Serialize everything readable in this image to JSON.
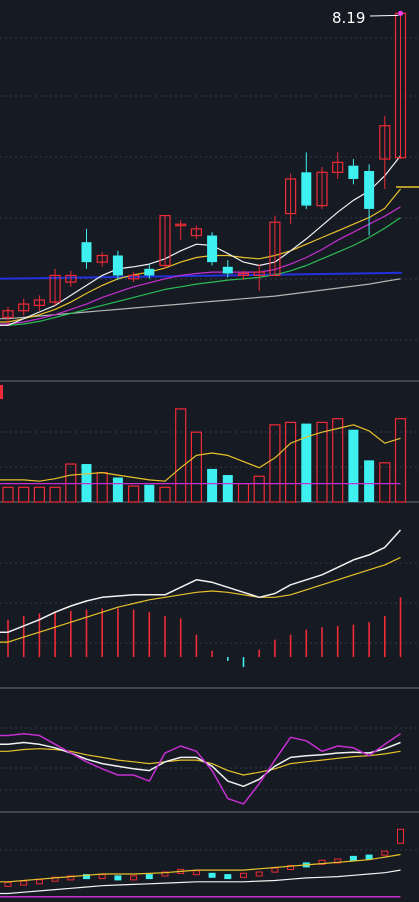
{
  "chart_data": {
    "type": "candlestick",
    "max_label": "8.19",
    "colors": {
      "background": "#161a23",
      "up": "#ef2b36",
      "down": "#3ff0f0",
      "grid": "#353a46",
      "divider": "#6a6f7a",
      "ma_white": "#f2f2f2",
      "ma_yellow": "#e8c22a",
      "ma_magenta": "#c62fd2",
      "ma_green": "#2bbd54",
      "ma_gray": "#b4b4b4",
      "blue_line": "#2233dd",
      "price_tick": "#e8c22a"
    },
    "price_ylim": [
      3.4,
      8.3
    ],
    "candles": [
      {
        "o": 3.62,
        "c": 3.72,
        "h": 3.78,
        "l": 3.52
      },
      {
        "o": 3.72,
        "c": 3.82,
        "h": 3.9,
        "l": 3.65
      },
      {
        "o": 3.8,
        "c": 3.88,
        "h": 3.95,
        "l": 3.72
      },
      {
        "o": 3.85,
        "c": 4.25,
        "h": 4.35,
        "l": 3.8
      },
      {
        "o": 4.15,
        "c": 4.25,
        "h": 4.32,
        "l": 4.08
      },
      {
        "o": 4.75,
        "c": 4.45,
        "h": 4.95,
        "l": 4.35
      },
      {
        "o": 4.45,
        "c": 4.55,
        "h": 4.6,
        "l": 4.38
      },
      {
        "o": 4.55,
        "c": 4.25,
        "h": 4.62,
        "l": 4.18
      },
      {
        "o": 4.2,
        "c": 4.25,
        "h": 4.3,
        "l": 4.15
      },
      {
        "o": 4.35,
        "c": 4.25,
        "h": 4.42,
        "l": 4.2
      },
      {
        "o": 4.4,
        "c": 5.15,
        "h": 5.15,
        "l": 4.35
      },
      {
        "o": 5.02,
        "c": 5.02,
        "h": 5.08,
        "l": 4.78
      },
      {
        "o": 4.85,
        "c": 4.95,
        "h": 5.0,
        "l": 4.8
      },
      {
        "o": 4.85,
        "c": 4.45,
        "h": 4.9,
        "l": 4.4
      },
      {
        "o": 4.38,
        "c": 4.28,
        "h": 4.48,
        "l": 4.22
      },
      {
        "o": 4.25,
        "c": 4.28,
        "h": 4.32,
        "l": 4.18
      },
      {
        "o": 4.25,
        "c": 4.3,
        "h": 4.42,
        "l": 4.02
      },
      {
        "o": 4.25,
        "c": 5.05,
        "h": 5.15,
        "l": 4.25
      },
      {
        "o": 5.18,
        "c": 5.7,
        "h": 5.78,
        "l": 5.02
      },
      {
        "o": 5.8,
        "c": 5.3,
        "h": 6.1,
        "l": 5.25
      },
      {
        "o": 5.3,
        "c": 5.8,
        "h": 5.88,
        "l": 5.25
      },
      {
        "o": 5.8,
        "c": 5.95,
        "h": 6.1,
        "l": 5.7
      },
      {
        "o": 5.9,
        "c": 5.7,
        "h": 6.0,
        "l": 5.62
      },
      {
        "o": 5.82,
        "c": 5.25,
        "h": 5.92,
        "l": 4.85
      },
      {
        "o": 6.0,
        "c": 6.5,
        "h": 6.65,
        "l": 5.55
      },
      {
        "o": 6.02,
        "c": 8.19,
        "h": 8.19,
        "l": 6.0
      }
    ],
    "ma_white": [
      3.5,
      3.6,
      3.7,
      3.8,
      3.95,
      4.1,
      4.25,
      4.35,
      4.38,
      4.42,
      4.5,
      4.62,
      4.72,
      4.7,
      4.58,
      4.45,
      4.4,
      4.45,
      4.62,
      4.8,
      5.0,
      5.2,
      5.38,
      5.52,
      5.75,
      6.05
    ],
    "ma_yellow": [
      3.55,
      3.6,
      3.66,
      3.74,
      3.85,
      3.98,
      4.1,
      4.2,
      4.26,
      4.3,
      4.36,
      4.45,
      4.52,
      4.55,
      4.55,
      4.52,
      4.5,
      4.55,
      4.62,
      4.72,
      4.82,
      4.92,
      5.02,
      5.12,
      5.26,
      5.55
    ],
    "ma_magenta": [
      3.52,
      3.55,
      3.6,
      3.66,
      3.74,
      3.82,
      3.92,
      4.0,
      4.08,
      4.14,
      4.2,
      4.25,
      4.28,
      4.3,
      4.3,
      4.3,
      4.3,
      4.34,
      4.42,
      4.52,
      4.64,
      4.78,
      4.9,
      5.02,
      5.14,
      5.28
    ],
    "ma_green": [
      3.5,
      3.52,
      3.56,
      3.62,
      3.68,
      3.74,
      3.8,
      3.86,
      3.92,
      3.98,
      4.04,
      4.08,
      4.12,
      4.15,
      4.18,
      4.2,
      4.22,
      4.26,
      4.32,
      4.4,
      4.5,
      4.6,
      4.7,
      4.82,
      4.96,
      5.12
    ],
    "ma_gray": [
      3.6,
      3.62,
      3.64,
      3.66,
      3.68,
      3.7,
      3.72,
      3.74,
      3.76,
      3.78,
      3.8,
      3.82,
      3.84,
      3.86,
      3.88,
      3.9,
      3.92,
      3.94,
      3.97,
      4.0,
      4.03,
      4.06,
      4.09,
      4.12,
      4.16,
      4.2
    ],
    "blue_level": 4.2,
    "price_tick_level": 5.58,
    "volume": [
      12,
      12,
      12,
      12,
      31,
      31,
      24,
      20,
      13,
      14,
      12,
      76,
      57,
      27,
      22,
      15,
      21,
      63,
      65,
      64,
      65,
      68,
      59,
      34,
      32,
      68
    ],
    "volume_ma_yellow": [
      18,
      18,
      17,
      19,
      22,
      23,
      24,
      22,
      20,
      18,
      17,
      28,
      38,
      40,
      38,
      33,
      28,
      36,
      48,
      53,
      57,
      60,
      63,
      58,
      48,
      52
    ],
    "volume_ma_magenta": [
      15,
      15,
      15,
      15,
      15,
      15,
      15,
      15,
      15,
      15,
      15,
      15,
      15,
      15,
      15,
      15,
      15,
      15,
      15,
      15,
      15,
      15,
      15,
      15,
      15,
      15
    ],
    "volume_ylim": [
      0,
      80
    ],
    "macd_hist": [
      0.3,
      0.33,
      0.35,
      0.36,
      0.37,
      0.38,
      0.39,
      0.39,
      0.38,
      0.36,
      0.33,
      0.31,
      0.18,
      0.05,
      -0.03,
      -0.08,
      0.06,
      0.14,
      0.18,
      0.22,
      0.24,
      0.25,
      0.26,
      0.28,
      0.33,
      0.48
    ],
    "macd_white": [
      0.2,
      0.25,
      0.3,
      0.36,
      0.41,
      0.45,
      0.48,
      0.49,
      0.5,
      0.5,
      0.5,
      0.56,
      0.62,
      0.6,
      0.56,
      0.52,
      0.48,
      0.51,
      0.58,
      0.62,
      0.66,
      0.72,
      0.78,
      0.82,
      0.88,
      1.02
    ],
    "macd_yellow": [
      0.12,
      0.16,
      0.2,
      0.24,
      0.28,
      0.32,
      0.36,
      0.4,
      0.43,
      0.46,
      0.48,
      0.5,
      0.52,
      0.53,
      0.52,
      0.5,
      0.48,
      0.48,
      0.5,
      0.54,
      0.58,
      0.62,
      0.66,
      0.7,
      0.74,
      0.8
    ],
    "macd_ylim": [
      -0.2,
      1.1
    ],
    "kdj_magenta": [
      80,
      82,
      80,
      70,
      60,
      50,
      42,
      35,
      35,
      28,
      60,
      68,
      62,
      40,
      8,
      2,
      25,
      52,
      78,
      74,
      62,
      68,
      66,
      57,
      70,
      82
    ],
    "kdj_white": [
      70,
      72,
      70,
      66,
      60,
      53,
      48,
      45,
      42,
      40,
      50,
      55,
      55,
      45,
      28,
      22,
      30,
      45,
      55,
      57,
      58,
      60,
      61,
      60,
      65,
      72
    ],
    "kdj_yellow": [
      62,
      64,
      65,
      64,
      62,
      58,
      55,
      52,
      50,
      48,
      50,
      52,
      52,
      48,
      40,
      35,
      38,
      42,
      48,
      50,
      52,
      54,
      56,
      57,
      59,
      62
    ],
    "kdj_ylim": [
      -5,
      100
    ],
    "bottom_ylim": [
      0,
      100
    ],
    "bottom_yellow": [
      28,
      30,
      32,
      34,
      36,
      38,
      40,
      40,
      40,
      41,
      42,
      44,
      46,
      46,
      46,
      46,
      48,
      50,
      52,
      54,
      56,
      58,
      60,
      62,
      66,
      70
    ],
    "bottom_white": [
      10,
      12,
      14,
      16,
      18,
      20,
      22,
      23,
      24,
      25,
      26,
      27,
      28,
      28,
      28,
      28,
      29,
      30,
      32,
      34,
      35,
      36,
      38,
      40,
      42,
      46
    ],
    "bottom_magenta": [
      5,
      5,
      5,
      5,
      5,
      5,
      5,
      5,
      5,
      5,
      5,
      5,
      5,
      5,
      5,
      5,
      5,
      5,
      5,
      5,
      5,
      5,
      5,
      5,
      5,
      5
    ],
    "bottom_bars": [
      24,
      26,
      28,
      32,
      34,
      36,
      36,
      34,
      34,
      36,
      40,
      44,
      42,
      38,
      36,
      38,
      40,
      46,
      50,
      54,
      58,
      60,
      64,
      66,
      72,
      98
    ]
  }
}
